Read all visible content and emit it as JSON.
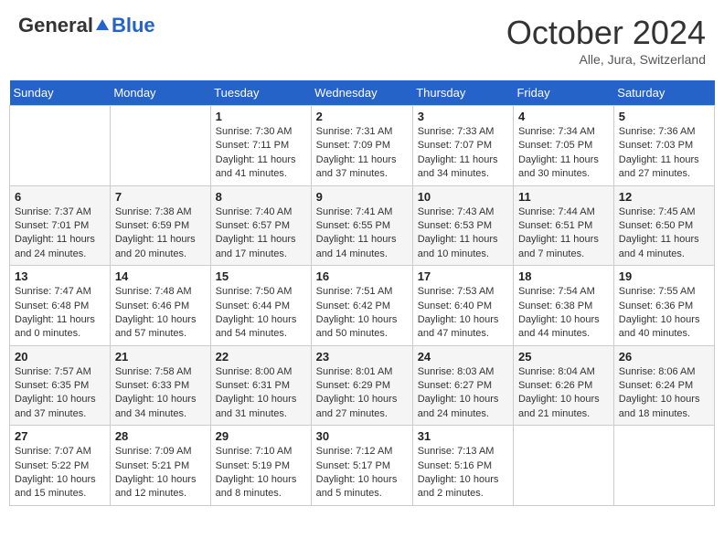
{
  "header": {
    "logo_general": "General",
    "logo_blue": "Blue",
    "month_title": "October 2024",
    "location": "Alle, Jura, Switzerland"
  },
  "weekdays": [
    "Sunday",
    "Monday",
    "Tuesday",
    "Wednesday",
    "Thursday",
    "Friday",
    "Saturday"
  ],
  "weeks": [
    [
      {
        "day": "",
        "info": ""
      },
      {
        "day": "",
        "info": ""
      },
      {
        "day": "1",
        "info": "Sunrise: 7:30 AM\nSunset: 7:11 PM\nDaylight: 11 hours and 41 minutes."
      },
      {
        "day": "2",
        "info": "Sunrise: 7:31 AM\nSunset: 7:09 PM\nDaylight: 11 hours and 37 minutes."
      },
      {
        "day": "3",
        "info": "Sunrise: 7:33 AM\nSunset: 7:07 PM\nDaylight: 11 hours and 34 minutes."
      },
      {
        "day": "4",
        "info": "Sunrise: 7:34 AM\nSunset: 7:05 PM\nDaylight: 11 hours and 30 minutes."
      },
      {
        "day": "5",
        "info": "Sunrise: 7:36 AM\nSunset: 7:03 PM\nDaylight: 11 hours and 27 minutes."
      }
    ],
    [
      {
        "day": "6",
        "info": "Sunrise: 7:37 AM\nSunset: 7:01 PM\nDaylight: 11 hours and 24 minutes."
      },
      {
        "day": "7",
        "info": "Sunrise: 7:38 AM\nSunset: 6:59 PM\nDaylight: 11 hours and 20 minutes."
      },
      {
        "day": "8",
        "info": "Sunrise: 7:40 AM\nSunset: 6:57 PM\nDaylight: 11 hours and 17 minutes."
      },
      {
        "day": "9",
        "info": "Sunrise: 7:41 AM\nSunset: 6:55 PM\nDaylight: 11 hours and 14 minutes."
      },
      {
        "day": "10",
        "info": "Sunrise: 7:43 AM\nSunset: 6:53 PM\nDaylight: 11 hours and 10 minutes."
      },
      {
        "day": "11",
        "info": "Sunrise: 7:44 AM\nSunset: 6:51 PM\nDaylight: 11 hours and 7 minutes."
      },
      {
        "day": "12",
        "info": "Sunrise: 7:45 AM\nSunset: 6:50 PM\nDaylight: 11 hours and 4 minutes."
      }
    ],
    [
      {
        "day": "13",
        "info": "Sunrise: 7:47 AM\nSunset: 6:48 PM\nDaylight: 11 hours and 0 minutes."
      },
      {
        "day": "14",
        "info": "Sunrise: 7:48 AM\nSunset: 6:46 PM\nDaylight: 10 hours and 57 minutes."
      },
      {
        "day": "15",
        "info": "Sunrise: 7:50 AM\nSunset: 6:44 PM\nDaylight: 10 hours and 54 minutes."
      },
      {
        "day": "16",
        "info": "Sunrise: 7:51 AM\nSunset: 6:42 PM\nDaylight: 10 hours and 50 minutes."
      },
      {
        "day": "17",
        "info": "Sunrise: 7:53 AM\nSunset: 6:40 PM\nDaylight: 10 hours and 47 minutes."
      },
      {
        "day": "18",
        "info": "Sunrise: 7:54 AM\nSunset: 6:38 PM\nDaylight: 10 hours and 44 minutes."
      },
      {
        "day": "19",
        "info": "Sunrise: 7:55 AM\nSunset: 6:36 PM\nDaylight: 10 hours and 40 minutes."
      }
    ],
    [
      {
        "day": "20",
        "info": "Sunrise: 7:57 AM\nSunset: 6:35 PM\nDaylight: 10 hours and 37 minutes."
      },
      {
        "day": "21",
        "info": "Sunrise: 7:58 AM\nSunset: 6:33 PM\nDaylight: 10 hours and 34 minutes."
      },
      {
        "day": "22",
        "info": "Sunrise: 8:00 AM\nSunset: 6:31 PM\nDaylight: 10 hours and 31 minutes."
      },
      {
        "day": "23",
        "info": "Sunrise: 8:01 AM\nSunset: 6:29 PM\nDaylight: 10 hours and 27 minutes."
      },
      {
        "day": "24",
        "info": "Sunrise: 8:03 AM\nSunset: 6:27 PM\nDaylight: 10 hours and 24 minutes."
      },
      {
        "day": "25",
        "info": "Sunrise: 8:04 AM\nSunset: 6:26 PM\nDaylight: 10 hours and 21 minutes."
      },
      {
        "day": "26",
        "info": "Sunrise: 8:06 AM\nSunset: 6:24 PM\nDaylight: 10 hours and 18 minutes."
      }
    ],
    [
      {
        "day": "27",
        "info": "Sunrise: 7:07 AM\nSunset: 5:22 PM\nDaylight: 10 hours and 15 minutes."
      },
      {
        "day": "28",
        "info": "Sunrise: 7:09 AM\nSunset: 5:21 PM\nDaylight: 10 hours and 12 minutes."
      },
      {
        "day": "29",
        "info": "Sunrise: 7:10 AM\nSunset: 5:19 PM\nDaylight: 10 hours and 8 minutes."
      },
      {
        "day": "30",
        "info": "Sunrise: 7:12 AM\nSunset: 5:17 PM\nDaylight: 10 hours and 5 minutes."
      },
      {
        "day": "31",
        "info": "Sunrise: 7:13 AM\nSunset: 5:16 PM\nDaylight: 10 hours and 2 minutes."
      },
      {
        "day": "",
        "info": ""
      },
      {
        "day": "",
        "info": ""
      }
    ]
  ]
}
